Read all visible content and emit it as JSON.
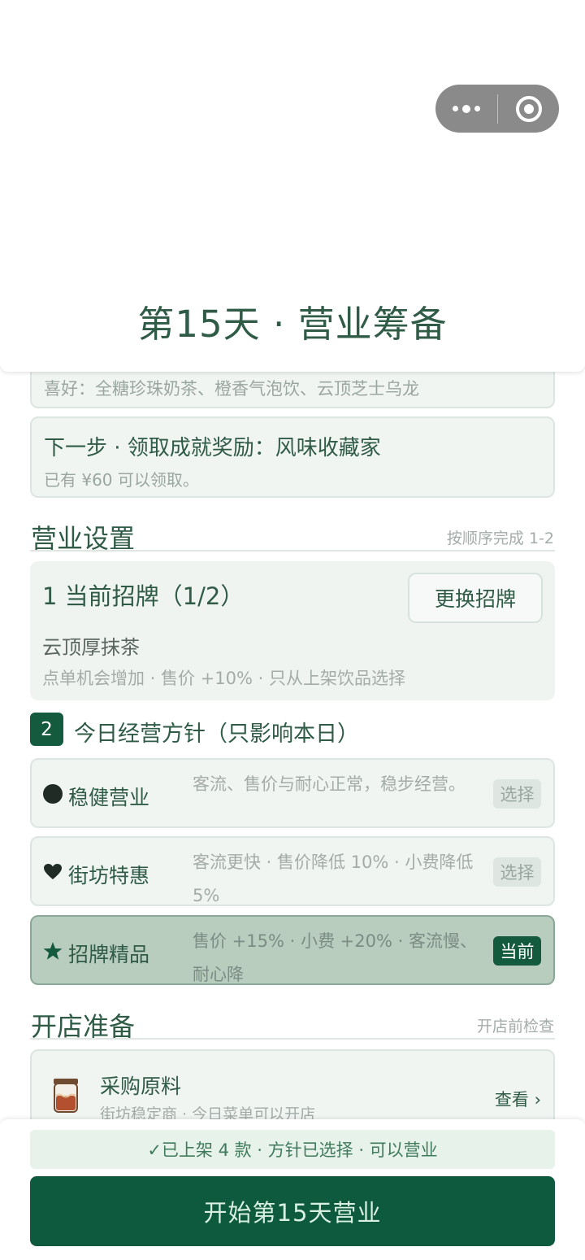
{
  "header": {
    "title": "第15天 · 营业筹备"
  },
  "prefs": {
    "text": "喜好：全糖珍珠奶茶、橙香气泡饮、云顶芝士乌龙"
  },
  "next_step": {
    "title": "下一步 · 领取成就奖励：风味收藏家",
    "subtitle": "已有 ¥60 可以领取。"
  },
  "business_settings": {
    "title": "营业设置",
    "hint": "按顺序完成 1-2"
  },
  "signboard": {
    "heading": "1  当前招牌（1/2）",
    "change_label": "更换招牌",
    "name": "云顶厚抹茶",
    "effects": "点单机会增加 · 售价 +10% · 只从上架饮品选择"
  },
  "policy_section": {
    "badge": "2",
    "title": "今日经营方针（只影响本日）"
  },
  "policies": [
    {
      "icon": "circle-icon",
      "name": "稳健营业",
      "desc": "客流、售价与耐心正常，稳步经营。",
      "action": "选择"
    },
    {
      "icon": "heart-icon",
      "name": "街坊特惠",
      "desc": "客流更快 · 售价降低 10% · 小费降低 5%",
      "action": "选择"
    },
    {
      "icon": "star-icon",
      "name": "招牌精品",
      "desc": "售价 +15% · 小费 +20% · 客流慢、耐心降",
      "action": "当前"
    }
  ],
  "opening_prep": {
    "title": "开店准备",
    "hint": "开店前检查"
  },
  "supply": {
    "icon": "jar-icon",
    "title": "采购原料",
    "subtitle": "街坊稳定商 · 今日菜单可以开店",
    "action": "查看 ›"
  },
  "footer": {
    "status": "✓已上架 4 款 · 方针已选择 · 可以营业",
    "start_label": "开始第15天营业"
  },
  "colors": {
    "accent": "#0e5a3e",
    "active_card": "#b9cdbf",
    "card_bg": "#f1f5f2"
  }
}
